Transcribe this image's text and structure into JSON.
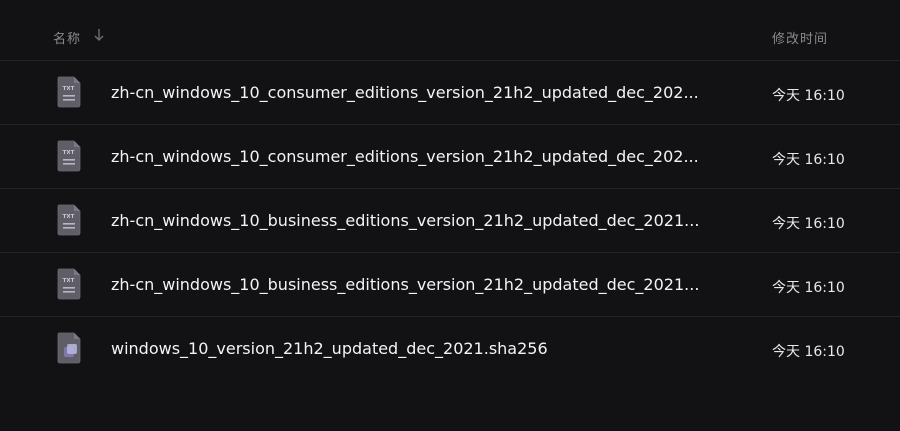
{
  "header": {
    "name_label": "名称",
    "modified_label": "修改时间",
    "sort_icon": "arrow-down-icon"
  },
  "files": [
    {
      "name": "zh-cn_windows_10_consumer_editions_version_21h2_updated_dec_202...",
      "modified": "今天 16:10",
      "icon": "txt-file-icon",
      "icon_label": "TXT"
    },
    {
      "name": "zh-cn_windows_10_consumer_editions_version_21h2_updated_dec_202...",
      "modified": "今天 16:10",
      "icon": "txt-file-icon",
      "icon_label": "TXT"
    },
    {
      "name": "zh-cn_windows_10_business_editions_version_21h2_updated_dec_2021...",
      "modified": "今天 16:10",
      "icon": "txt-file-icon",
      "icon_label": "TXT"
    },
    {
      "name": "zh-cn_windows_10_business_editions_version_21h2_updated_dec_2021...",
      "modified": "今天 16:10",
      "icon": "txt-file-icon",
      "icon_label": "TXT"
    },
    {
      "name": "windows_10_version_21h2_updated_dec_2021.sha256",
      "modified": "今天 16:10",
      "icon": "generic-file-icon"
    }
  ]
}
